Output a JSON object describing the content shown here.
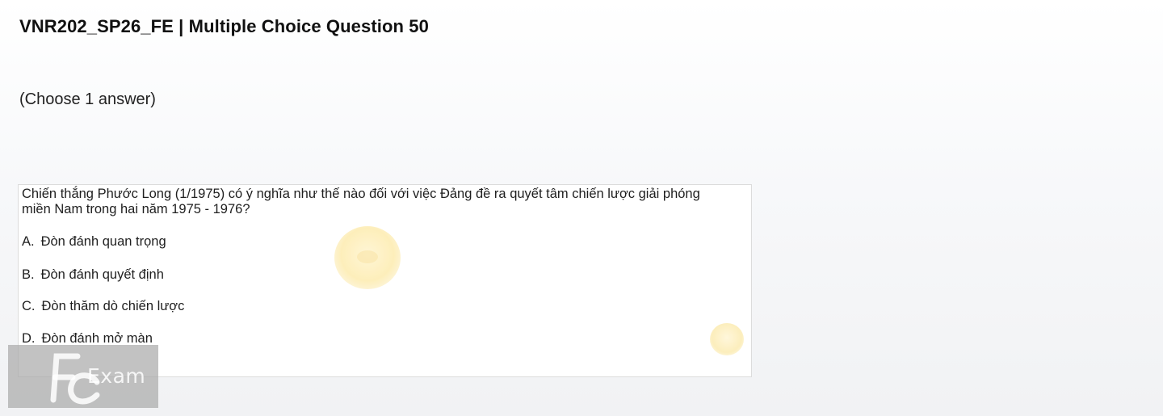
{
  "header": {
    "title": "VNR202_SP26_FE | Multiple Choice Question 50"
  },
  "instruction": "(Choose 1 answer)",
  "question": {
    "text": "Chiến thắng Phước Long (1/1975) có ý nghĩa như thế nào đối với việc Đảng đề ra quyết tâm chiến lược giải phóng miền Nam trong hai năm 1975 - 1976?",
    "options": [
      {
        "letter": "A.",
        "text": "Đòn đánh quan trọng"
      },
      {
        "letter": "B.",
        "text": "Đòn đánh quyết định"
      },
      {
        "letter": "C.",
        "text": "Đòn thăm dò chiến lược"
      },
      {
        "letter": "D.",
        "text": "Đòn đánh mở màn"
      }
    ]
  },
  "watermark": {
    "word": "Exam",
    "logo_icon": "fu-logo-icon",
    "color": "#aaaaaa"
  }
}
